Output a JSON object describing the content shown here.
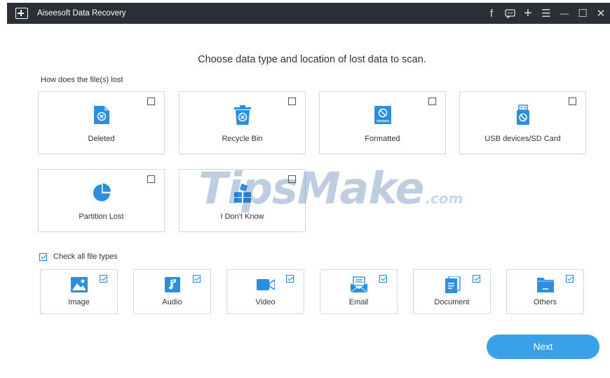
{
  "window": {
    "title": "Aiseesoft Data Recovery",
    "controls": [
      {
        "name": "facebook-icon",
        "glyph": "f"
      },
      {
        "name": "feedback-icon",
        "glyph": "▣"
      },
      {
        "name": "plus-icon",
        "glyph": "+"
      },
      {
        "name": "menu-icon",
        "glyph": "☰"
      },
      {
        "name": "minimize-icon",
        "glyph": "—"
      },
      {
        "name": "maximize-icon",
        "glyph": "☐"
      },
      {
        "name": "close-icon",
        "glyph": "✕"
      }
    ]
  },
  "heading": "Choose data type and location of lost data to scan.",
  "loss_section": {
    "label": "How does the file(s) lost",
    "options": [
      {
        "label": "Deleted",
        "icon": "deleted-file-icon",
        "checked": false
      },
      {
        "label": "Recycle Bin",
        "icon": "recycle-bin-icon",
        "checked": false
      },
      {
        "label": "Formatted",
        "icon": "formatted-drive-icon",
        "checked": false
      },
      {
        "label": "USB devices/SD Card",
        "icon": "usb-drive-icon",
        "checked": false
      },
      {
        "label": "Partition Lost",
        "icon": "partition-pie-icon",
        "checked": false
      },
      {
        "label": "I Don't Know",
        "icon": "unknown-blocks-icon",
        "checked": false
      }
    ]
  },
  "file_types": {
    "check_all_label": "Check all file types",
    "check_all": true,
    "types": [
      {
        "label": "Image",
        "icon": "image-icon",
        "checked": true
      },
      {
        "label": "Audio",
        "icon": "audio-icon",
        "checked": true
      },
      {
        "label": "Video",
        "icon": "video-icon",
        "checked": true
      },
      {
        "label": "Email",
        "icon": "email-icon",
        "checked": true
      },
      {
        "label": "Document",
        "icon": "document-icon",
        "checked": true
      },
      {
        "label": "Others",
        "icon": "folder-icon",
        "checked": true
      }
    ]
  },
  "next_label": "Next",
  "watermark": {
    "main": "TipsMake",
    "suffix": ".com"
  },
  "colors": {
    "accent": "#3aa1e8",
    "titlebar": "#2b2f38",
    "card_border": "#c9dbee",
    "icon_blue": "#2b8fe0"
  }
}
